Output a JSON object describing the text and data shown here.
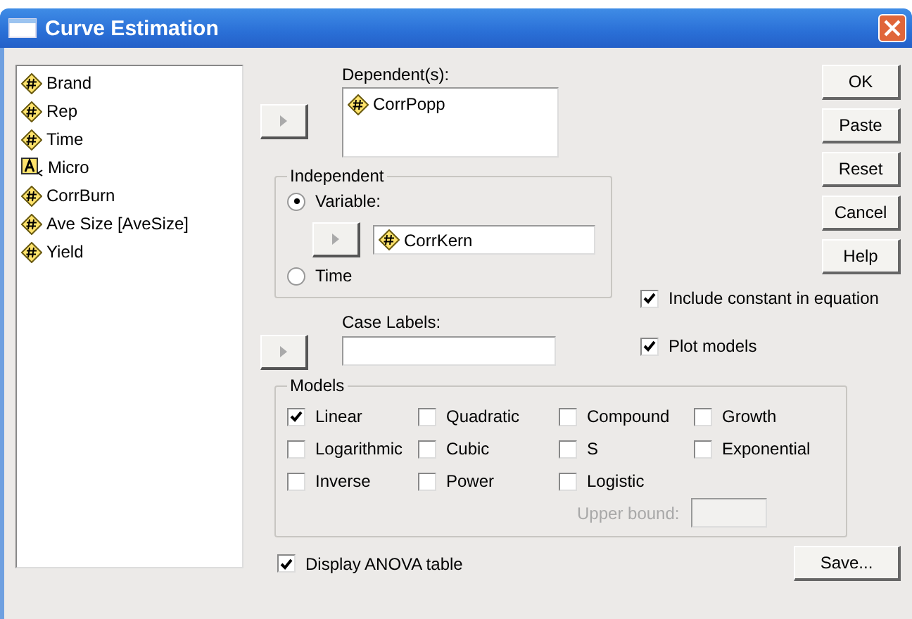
{
  "window": {
    "title": "Curve Estimation"
  },
  "variables": [
    {
      "name": "Brand",
      "kind": "numeric"
    },
    {
      "name": "Rep",
      "kind": "numeric"
    },
    {
      "name": "Time",
      "kind": "numeric"
    },
    {
      "name": "Micro",
      "kind": "string"
    },
    {
      "name": "CorrBurn",
      "kind": "numeric"
    },
    {
      "name": "Ave Size [AveSize]",
      "kind": "numeric"
    },
    {
      "name": "Yield",
      "kind": "numeric"
    }
  ],
  "dependent": {
    "label": "Dependent(s):",
    "items": [
      {
        "name": "CorrPopp",
        "kind": "numeric"
      }
    ]
  },
  "independent": {
    "title": "Independent",
    "options": [
      {
        "label": "Variable:",
        "selected": true
      },
      {
        "label": "Time",
        "selected": false
      }
    ],
    "variable": {
      "name": "CorrKern",
      "kind": "numeric"
    }
  },
  "case_labels": {
    "label": "Case Labels:"
  },
  "buttons": [
    "OK",
    "Paste",
    "Reset",
    "Cancel",
    "Help"
  ],
  "options": [
    {
      "label": "Include constant in equation",
      "checked": true
    },
    {
      "label": "Plot models",
      "checked": true
    }
  ],
  "models": {
    "title": "Models",
    "columns": [
      [
        {
          "label": "Linear",
          "checked": true
        },
        {
          "label": "Logarithmic",
          "checked": false
        },
        {
          "label": "Inverse",
          "checked": false
        }
      ],
      [
        {
          "label": "Quadratic",
          "checked": false
        },
        {
          "label": "Cubic",
          "checked": false
        },
        {
          "label": "Power",
          "checked": false
        }
      ],
      [
        {
          "label": "Compound",
          "checked": false
        },
        {
          "label": "S",
          "checked": false
        },
        {
          "label": "Logistic",
          "checked": false
        }
      ],
      [
        {
          "label": "Growth",
          "checked": false
        },
        {
          "label": "Exponential",
          "checked": false
        }
      ]
    ],
    "upper_bound": {
      "label": "Upper bound:",
      "disabled": true
    }
  },
  "display_anova": {
    "label": "Display ANOVA table",
    "checked": true
  },
  "save_button": "Save..."
}
